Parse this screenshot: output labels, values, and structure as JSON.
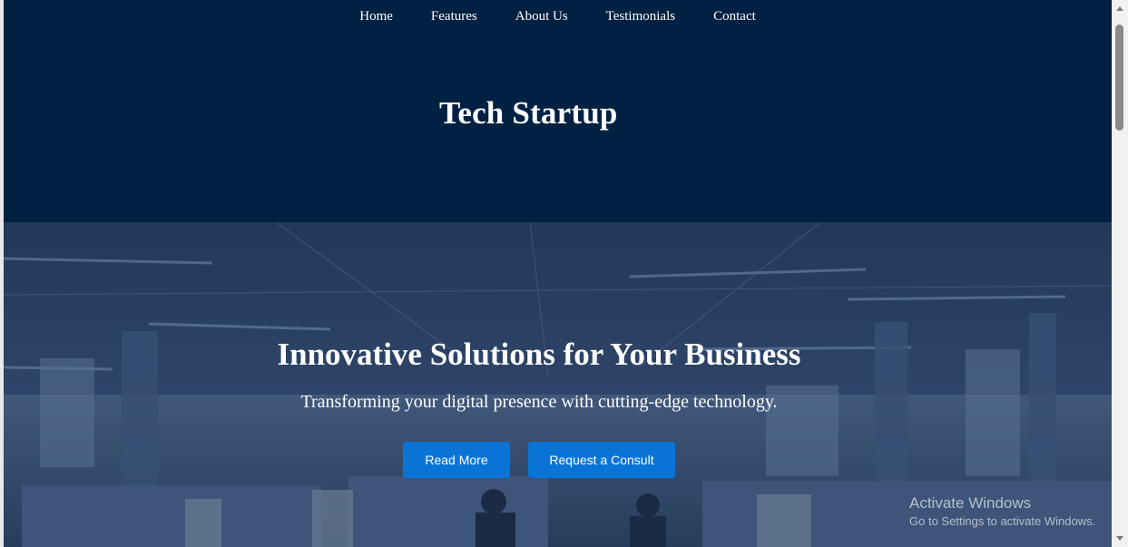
{
  "nav": {
    "links": [
      "Home",
      "Features",
      "About Us",
      "Testimonials",
      "Contact"
    ]
  },
  "header": {
    "brand": "Tech Startup"
  },
  "hero": {
    "title": "Innovative Solutions for Your Business",
    "subtitle": "Transforming your digital presence with cutting-edge technology.",
    "buttons": {
      "read_more": "Read More",
      "consult": "Request a Consult"
    }
  },
  "watermark": {
    "title": "Activate Windows",
    "subtitle": "Go to Settings to activate Windows."
  },
  "colors": {
    "header_bg": "#012143",
    "button_bg": "#0a74d6",
    "text": "#ffffff"
  },
  "icons": [
    "scroll-up-arrow-icon",
    "scroll-down-arrow-icon"
  ]
}
